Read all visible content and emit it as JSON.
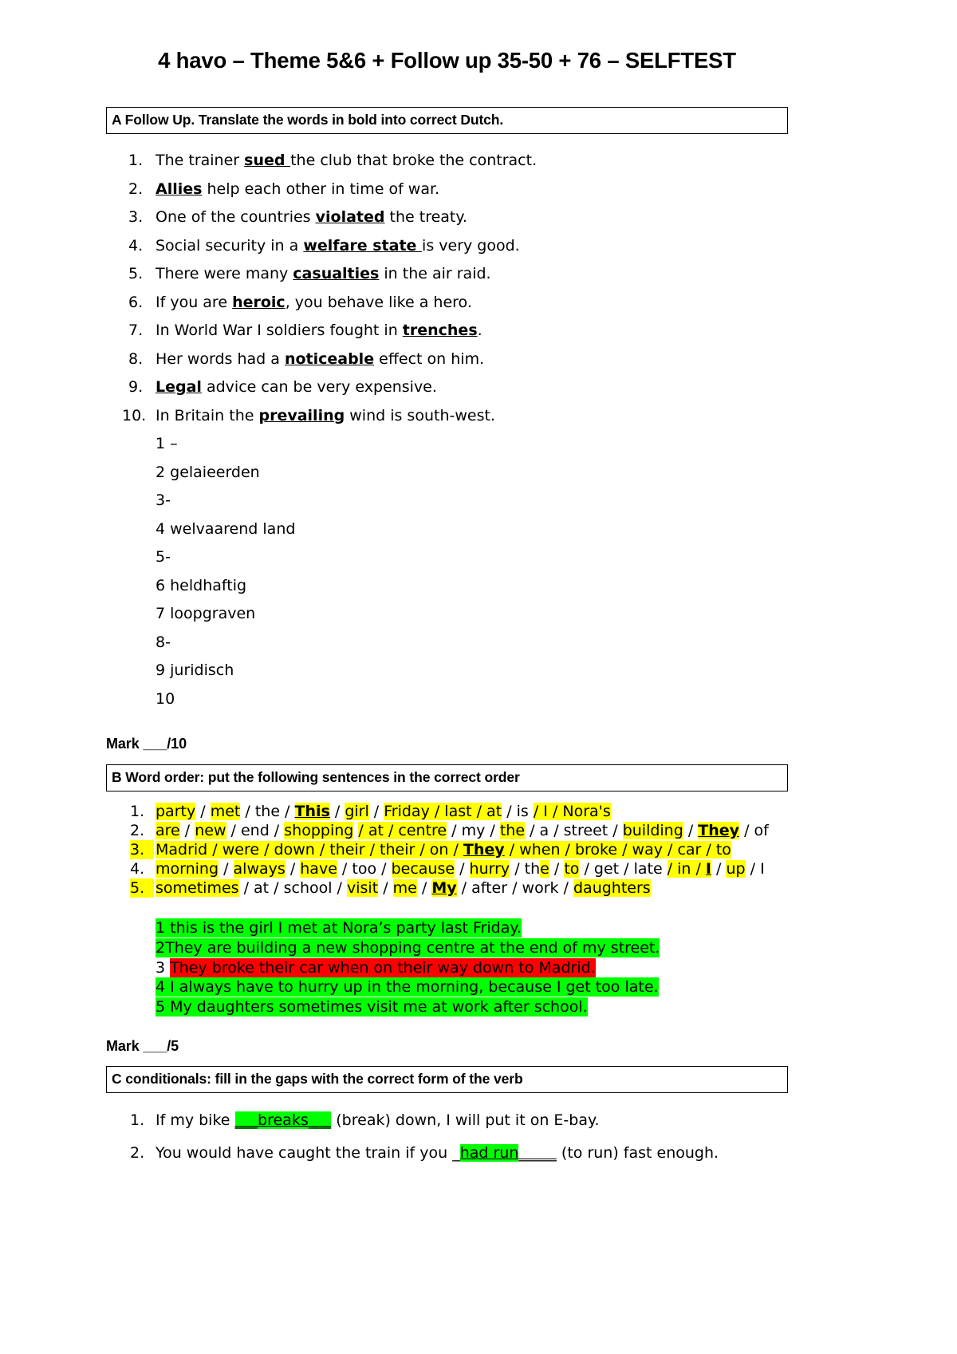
{
  "document": {
    "title": "4 havo – Theme 5&6 + Follow up 35-50 + 76 – SELFTEST"
  },
  "colors": {
    "highlight_yellow": "#ffff00",
    "highlight_green": "#00ff00",
    "highlight_red": "#ff0000",
    "text": "#000000",
    "page": "#ffffff"
  },
  "section_a": {
    "heading": "A Follow Up. Translate the words in bold into correct Dutch.",
    "items": [
      {
        "num": "1.",
        "pre": "The trainer ",
        "bold": "sued ",
        "post": "the club that broke the contract."
      },
      {
        "num": "2.",
        "pre": "",
        "bold": "Allies",
        "post": " help each other in time of war."
      },
      {
        "num": "3.",
        "pre": "One of the countries ",
        "bold": "violated",
        "post": " the treaty."
      },
      {
        "num": "4.",
        "pre": "Social security in a ",
        "bold": "welfare state ",
        "post": " is very good."
      },
      {
        "num": "5.",
        "pre": "There were many ",
        "bold": "casualties",
        "post": " in the air raid."
      },
      {
        "num": "6.",
        "pre": "If you are ",
        "bold": "heroic",
        "post": ", you behave like a hero."
      },
      {
        "num": "7.",
        "pre": "In World War I soldiers fought in ",
        "bold": "trenches",
        "post": "."
      },
      {
        "num": "8.",
        "pre": "Her words had a ",
        "bold": "noticeable",
        "post": " effect on him."
      },
      {
        "num": "9.",
        "pre": "",
        "bold": "Legal",
        "post": " advice can be very expensive."
      },
      {
        "num": "10.",
        "pre": "In Britain the ",
        "bold": "prevailing",
        "post": " wind is south-west."
      }
    ],
    "answers": [
      "1 –",
      "2  gelaieerden",
      "3-",
      "4 welvaarend land",
      "5-",
      "6 heldhaftig",
      "7 loopgraven",
      "8-",
      "9 juridisch",
      "10"
    ],
    "mark": "Mark ___/10"
  },
  "section_b": {
    "heading": "B Word order: put the following sentences in the correct order",
    "items": [
      {
        "num": "1.",
        "segments": [
          {
            "text": "party",
            "hl": "yellow"
          },
          {
            "text": " / ",
            "hl": "none"
          },
          {
            "text": "met",
            "hl": "yellow"
          },
          {
            "text": " / the / ",
            "hl": "none"
          },
          {
            "text": "This",
            "hl": "yellow",
            "style": "bold-underline"
          },
          {
            "text": " / ",
            "hl": "none"
          },
          {
            "text": "girl",
            "hl": "yellow"
          },
          {
            "text": " / ",
            "hl": "none"
          },
          {
            "text": "Friday / last / at",
            "hl": "yellow"
          },
          {
            "text": " / is ",
            "hl": "none"
          },
          {
            "text": "/ I / ",
            "hl": "yellow"
          },
          {
            "text": "Nora's",
            "hl": "yellow"
          }
        ]
      },
      {
        "num": "2.",
        "segments": [
          {
            "text": "are",
            "hl": "yellow"
          },
          {
            "text": " / ",
            "hl": "none"
          },
          {
            "text": "new",
            "hl": "yellow"
          },
          {
            "text": " / end / ",
            "hl": "none"
          },
          {
            "text": "shopping",
            "hl": "yellow"
          },
          {
            "text": " ",
            "hl": "none"
          },
          {
            "text": "/ at / centre",
            "hl": "yellow"
          },
          {
            "text": " / my / ",
            "hl": "none"
          },
          {
            "text": "the",
            "hl": "yellow"
          },
          {
            "text": " / a / street / ",
            "hl": "none"
          },
          {
            "text": "building",
            "hl": "yellow"
          },
          {
            "text": " / ",
            "hl": "none"
          },
          {
            "text": "They",
            "hl": "yellow",
            "style": "bold-underline"
          },
          {
            "text": " / of",
            "hl": "none"
          }
        ]
      },
      {
        "num": "3.",
        "full_highlight": "yellow",
        "segments": [
          {
            "text": "Madrid / were / down / their / their / on / ",
            "hl": "yellow"
          },
          {
            "text": "They",
            "hl": "yellow",
            "style": "bold-underline"
          },
          {
            "text": " / when / broke / way / car / to",
            "hl": "yellow"
          }
        ]
      },
      {
        "num": "4.",
        "segments": [
          {
            "text": "morning",
            "hl": "yellow"
          },
          {
            "text": " / ",
            "hl": "none"
          },
          {
            "text": "always",
            "hl": "yellow"
          },
          {
            "text": " / ",
            "hl": "none"
          },
          {
            "text": "have",
            "hl": "yellow"
          },
          {
            "text": " / too / ",
            "hl": "none"
          },
          {
            "text": "because",
            "hl": "yellow"
          },
          {
            "text": " / ",
            "hl": "none"
          },
          {
            "text": "hurry",
            "hl": "yellow"
          },
          {
            "text": " / th",
            "hl": "none"
          },
          {
            "text": "e",
            "hl": "yellow"
          },
          {
            "text": " / ",
            "hl": "none"
          },
          {
            "text": "to",
            "hl": "yellow"
          },
          {
            "text": " / get / late ",
            "hl": "none"
          },
          {
            "text": "/ in / ",
            "hl": "yellow"
          },
          {
            "text": "I",
            "hl": "yellow",
            "style": "bold-underline"
          },
          {
            "text": " / ",
            "hl": "none"
          },
          {
            "text": "up",
            "hl": "yellow"
          },
          {
            "text": " / I",
            "hl": "none"
          }
        ]
      },
      {
        "num": "5.",
        "segments": [
          {
            "text": "sometimes",
            "hl": "yellow"
          },
          {
            "text": " / at / school / ",
            "hl": "none"
          },
          {
            "text": "visit",
            "hl": "yellow"
          },
          {
            "text": " / ",
            "hl": "none"
          },
          {
            "text": "me",
            "hl": "yellow"
          },
          {
            "text": " / ",
            "hl": "none"
          },
          {
            "text": "My",
            "hl": "yellow",
            "style": "bold-underline"
          },
          {
            "text": " / after / work / ",
            "hl": "none"
          },
          {
            "text": "daughters",
            "hl": "yellow"
          }
        ]
      }
    ],
    "answers": [
      {
        "text": "1 this is the girl I met at Nora’s party last Friday.",
        "hl": "green"
      },
      {
        "text": "2They are building a new shopping centre at the end of my street.",
        "hl": "green"
      },
      {
        "prefix": "3 ",
        "text": "They broke their car when on their way down to Madrid.",
        "hl": "red"
      },
      {
        "text": "4 I always have to hurry up in the morning, because I get too late.",
        "hl": "green"
      },
      {
        "text": "5 My daughters sometimes visit me at work after school.",
        "hl": "green"
      }
    ],
    "mark": "Mark ___/5"
  },
  "section_c": {
    "heading": "C conditionals: fill in the gaps with the correct form of the verb",
    "items": [
      {
        "num": "1.",
        "pre": "If my bike ",
        "gap_lead": "___",
        "gap_answer": "breaks",
        "gap_trail": "___",
        "post": " (break) down, I will put it on E-bay."
      },
      {
        "num": "2.",
        "pre": "You would have caught the train if you _",
        "gap_lead": "",
        "gap_answer": "had run",
        "gap_trail": "_____",
        "post": " (to run) fast enough."
      }
    ]
  }
}
